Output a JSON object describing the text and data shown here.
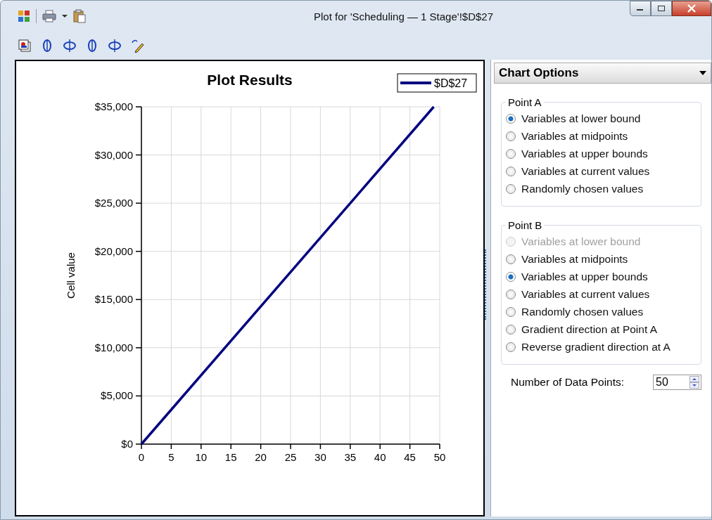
{
  "window": {
    "title": "Plot for 'Scheduling — 1 Stage'!$D$27"
  },
  "chart": {
    "chart_data": {
      "type": "line",
      "grid": true,
      "title": "Plot Results",
      "ylabel": "Cell value",
      "x": [
        0,
        49
      ],
      "series": [
        {
          "name": "$D$27",
          "color": "#000080",
          "values": [
            0,
            35000
          ]
        }
      ],
      "xlim": [
        0,
        50
      ],
      "ylim": [
        0,
        35000
      ],
      "xticks": [
        0,
        5,
        10,
        15,
        20,
        25,
        30,
        35,
        40,
        45,
        50
      ],
      "yticks": [
        {
          "value": 0,
          "label": "$0"
        },
        {
          "value": 5000,
          "label": "$5,000"
        },
        {
          "value": 10000,
          "label": "$10,000"
        },
        {
          "value": 15000,
          "label": "$15,000"
        },
        {
          "value": 20000,
          "label": "$20,000"
        },
        {
          "value": 25000,
          "label": "$25,000"
        },
        {
          "value": 30000,
          "label": "$30,000"
        },
        {
          "value": 35000,
          "label": "$35,000"
        }
      ]
    }
  },
  "panel": {
    "title": "Chart Options",
    "groups": [
      {
        "title": "Point A",
        "options": [
          {
            "label": "Variables at lower bound",
            "selected": true,
            "disabled": false
          },
          {
            "label": "Variables at midpoints",
            "selected": false,
            "disabled": false
          },
          {
            "label": "Variables at upper bounds",
            "selected": false,
            "disabled": false
          },
          {
            "label": "Variables at current values",
            "selected": false,
            "disabled": false
          },
          {
            "label": "Randomly chosen values",
            "selected": false,
            "disabled": false
          }
        ]
      },
      {
        "title": "Point B",
        "options": [
          {
            "label": "Variables at lower bound",
            "selected": false,
            "disabled": true
          },
          {
            "label": "Variables at midpoints",
            "selected": false,
            "disabled": false
          },
          {
            "label": "Variables at upper bounds",
            "selected": true,
            "disabled": false
          },
          {
            "label": "Variables at current values",
            "selected": false,
            "disabled": false
          },
          {
            "label": "Randomly chosen values",
            "selected": false,
            "disabled": false
          },
          {
            "label": "Gradient direction at Point A",
            "selected": false,
            "disabled": false
          },
          {
            "label": "Reverse gradient direction at A",
            "selected": false,
            "disabled": false
          }
        ]
      }
    ],
    "data_points": {
      "label": "Number of Data Points:",
      "value": "50"
    }
  }
}
